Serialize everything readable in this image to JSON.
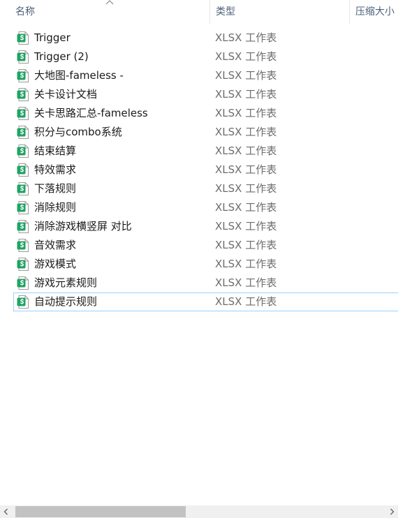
{
  "header": {
    "name_label": "名称",
    "type_label": "类型",
    "size_label": "压缩大小",
    "sort": "ascending"
  },
  "file_icon": "spreadsheet-s-icon",
  "accent_color": "#21a366",
  "files": [
    {
      "name": "Trigger",
      "type": "XLSX 工作表"
    },
    {
      "name": "Trigger (2)",
      "type": "XLSX 工作表"
    },
    {
      "name": "大地图-fameless  -",
      "type": "XLSX 工作表"
    },
    {
      "name": "关卡设计文档",
      "type": "XLSX 工作表"
    },
    {
      "name": "关卡思路汇总-fameless",
      "type": "XLSX 工作表"
    },
    {
      "name": "积分与combo系统",
      "type": "XLSX 工作表"
    },
    {
      "name": "结束结算",
      "type": "XLSX 工作表"
    },
    {
      "name": "特效需求",
      "type": "XLSX 工作表"
    },
    {
      "name": "下落规则",
      "type": "XLSX 工作表"
    },
    {
      "name": "消除规则",
      "type": "XLSX 工作表"
    },
    {
      "name": "消除游戏横竖屏 对比",
      "type": "XLSX 工作表"
    },
    {
      "name": "音效需求",
      "type": "XLSX 工作表"
    },
    {
      "name": "游戏模式",
      "type": "XLSX 工作表"
    },
    {
      "name": "游戏元素规则",
      "type": "XLSX 工作表"
    },
    {
      "name": "自动提示规则",
      "type": "XLSX 工作表",
      "selected": true
    }
  ]
}
